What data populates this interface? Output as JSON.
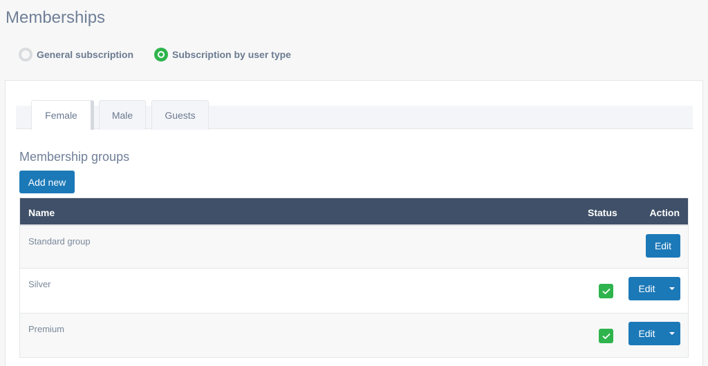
{
  "page": {
    "title": "Memberships"
  },
  "subscription_mode": {
    "options": [
      {
        "label": "General subscription",
        "selected": false
      },
      {
        "label": "Subscription by user type",
        "selected": true
      }
    ]
  },
  "tabs": [
    {
      "label": "Female",
      "active": true
    },
    {
      "label": "Male",
      "active": false
    },
    {
      "label": "Guests",
      "active": false
    }
  ],
  "section": {
    "title": "Membership groups",
    "add_button_label": "Add new"
  },
  "table": {
    "columns": {
      "name": "Name",
      "status": "Status",
      "action": "Action"
    },
    "rows": [
      {
        "name": "Standard group",
        "status_checked": null,
        "action_label": "Edit",
        "has_dropdown": false
      },
      {
        "name": "Silver",
        "status_checked": true,
        "action_label": "Edit",
        "has_dropdown": true
      },
      {
        "name": "Premium",
        "status_checked": true,
        "action_label": "Edit",
        "has_dropdown": true
      }
    ]
  },
  "colors": {
    "primary": "#1c79b8",
    "success": "#2fb44d",
    "table_header": "#3f5068"
  }
}
